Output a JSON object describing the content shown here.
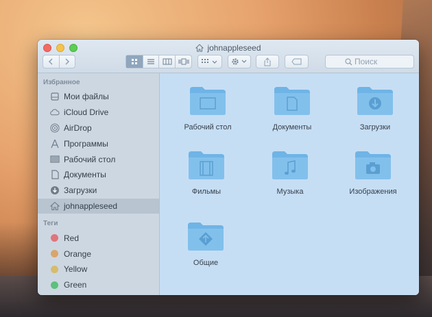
{
  "window": {
    "title": "johnappleseed"
  },
  "toolbar": {
    "search_placeholder": "Поиск",
    "view_modes": [
      "icons",
      "list",
      "columns",
      "cover-flow"
    ],
    "active_view": "icons"
  },
  "sidebar": {
    "favorites_heading": "Избранное",
    "favorites": [
      {
        "label": "Мои файлы",
        "icon": "all-my-files-icon"
      },
      {
        "label": "iCloud Drive",
        "icon": "cloud-icon"
      },
      {
        "label": "AirDrop",
        "icon": "airdrop-icon"
      },
      {
        "label": "Программы",
        "icon": "applications-icon"
      },
      {
        "label": "Рабочий стол",
        "icon": "desktop-icon"
      },
      {
        "label": "Документы",
        "icon": "documents-icon"
      },
      {
        "label": "Загрузки",
        "icon": "downloads-icon"
      },
      {
        "label": "johnappleseed",
        "icon": "home-icon",
        "selected": true
      }
    ],
    "tags_heading": "Теги",
    "tags": [
      {
        "label": "Red",
        "color": "#e0757a"
      },
      {
        "label": "Orange",
        "color": "#d9a56a"
      },
      {
        "label": "Yellow",
        "color": "#d6bc6c"
      },
      {
        "label": "Green",
        "color": "#5cc17c"
      }
    ]
  },
  "content": {
    "folders": [
      {
        "label": "Рабочий стол",
        "icon": "desktop-folder-icon"
      },
      {
        "label": "Документы",
        "icon": "documents-folder-icon"
      },
      {
        "label": "Загрузки",
        "icon": "downloads-folder-icon"
      },
      {
        "label": "Фильмы",
        "icon": "movies-folder-icon"
      },
      {
        "label": "Музыка",
        "icon": "music-folder-icon"
      },
      {
        "label": "Изображения",
        "icon": "pictures-folder-icon"
      },
      {
        "label": "Общие",
        "icon": "public-folder-icon"
      }
    ]
  },
  "colors": {
    "folder": "#6fb4e6",
    "selection": "#b8c4d0",
    "content_bg": "#c6def4"
  }
}
